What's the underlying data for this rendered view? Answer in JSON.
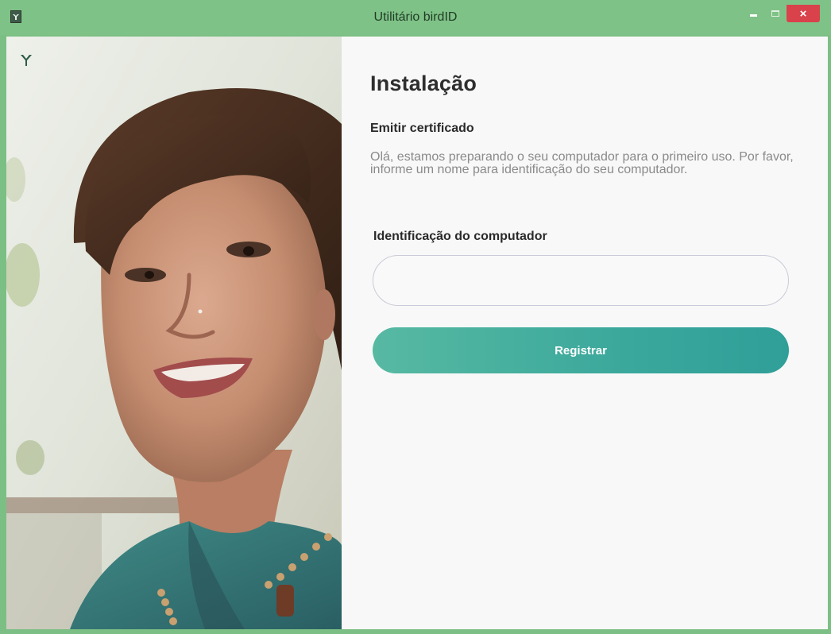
{
  "window": {
    "title": "Utilitário birdID",
    "controls": {
      "minimize": "–",
      "maximize": "□",
      "close": "×"
    },
    "app_icon": "birdid-app-icon"
  },
  "brand": {
    "logo_icon": "birdid-logo-icon"
  },
  "photo": {
    "description_icon": "smiling-woman-photo"
  },
  "form": {
    "title": "Instalação",
    "section_title": "Emitir certificado",
    "description": "Olá, estamos preparando o seu computador para o primeiro uso. Por favor, informe um nome para identificação do seu computador.",
    "field_label": "Identificação do computador",
    "field_value": "",
    "field_placeholder": "",
    "submit_label": "Registrar"
  },
  "colors": {
    "titlebar": "#7fc287",
    "accent_start": "#57b9a2",
    "accent_end": "#2f9f98",
    "close_button": "#d9424b"
  }
}
